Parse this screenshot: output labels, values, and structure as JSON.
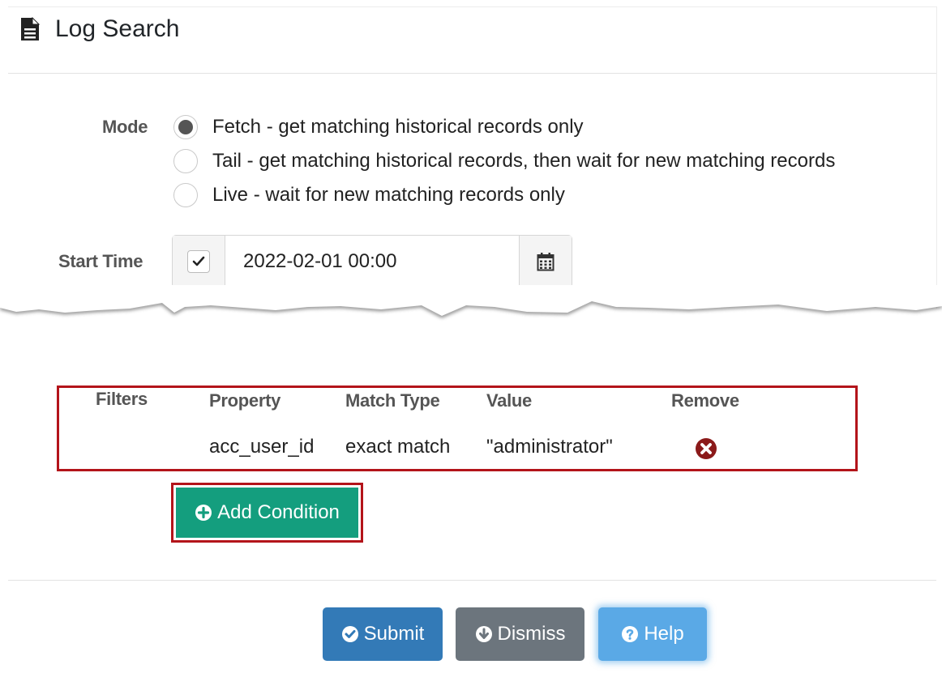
{
  "header": {
    "title": "Log Search",
    "icon": "file-text-icon"
  },
  "mode": {
    "label": "Mode",
    "options": [
      {
        "label": "Fetch - get matching historical records only",
        "checked": true
      },
      {
        "label": "Tail - get matching historical records, then wait for new matching records",
        "checked": false
      },
      {
        "label": "Live - wait for new matching records only",
        "checked": false
      }
    ]
  },
  "start_time": {
    "label": "Start Time",
    "enabled": true,
    "value": "2022-02-01 00:00",
    "icon": "calendar-icon"
  },
  "filters": {
    "label": "Filters",
    "columns": {
      "property": "Property",
      "match_type": "Match Type",
      "value": "Value",
      "remove": "Remove"
    },
    "rows": [
      {
        "property": "acc_user_id",
        "match_type": "exact match",
        "value": "\"administrator\""
      }
    ]
  },
  "add_condition": {
    "label": "Add Condition",
    "icon": "plus-circle-icon"
  },
  "footer": {
    "submit": "Submit",
    "dismiss": "Dismiss",
    "help": "Help"
  },
  "colors": {
    "highlight": "#b3141a",
    "add_button": "#149e7e",
    "submit": "#337ab7",
    "dismiss": "#6c757d",
    "help": "#5aa9e6",
    "remove_icon": "#8b1a1a"
  }
}
